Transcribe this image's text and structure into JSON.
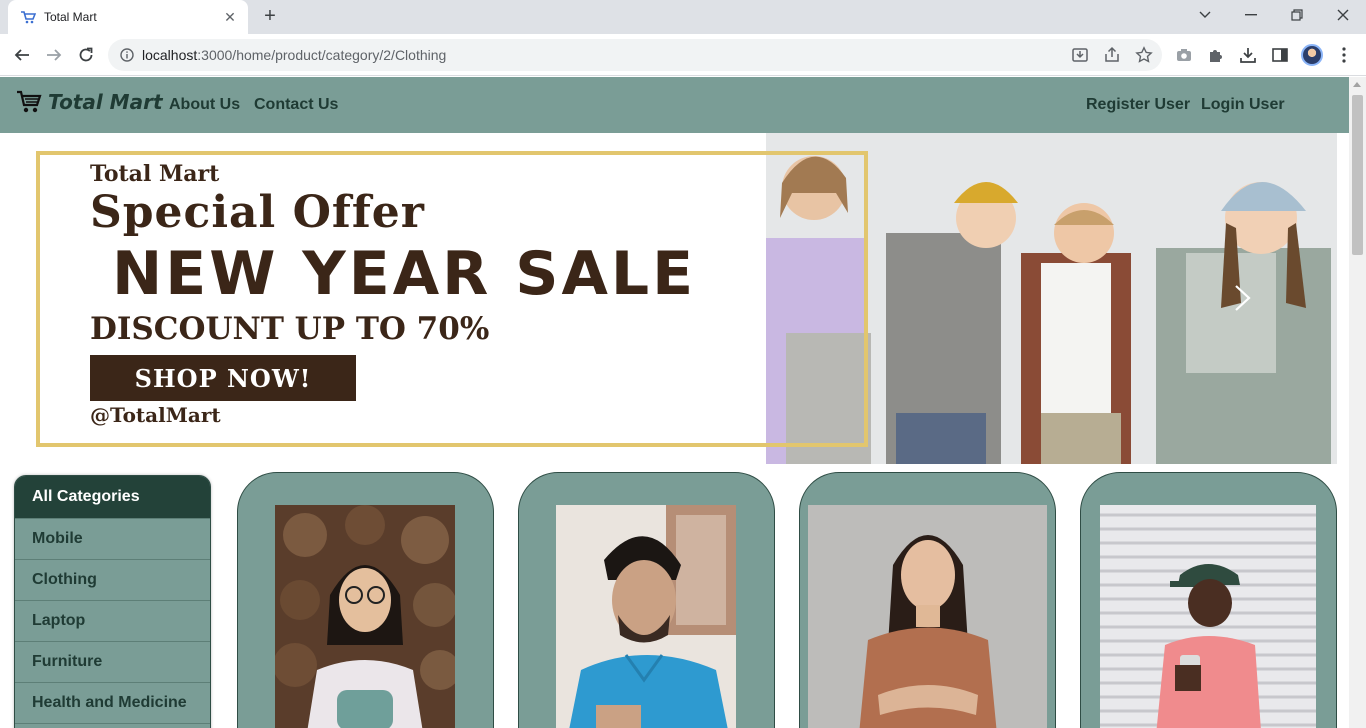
{
  "browser": {
    "tab_title": "Total Mart",
    "url_host": "localhost",
    "url_path": ":3000/home/product/category/2/Clothing"
  },
  "site": {
    "brand": "Total Mart",
    "nav_left": [
      "About Us",
      "Contact Us"
    ],
    "nav_right": [
      "Register User",
      "Login User"
    ],
    "colors": {
      "nav_bg": "#7a9d96",
      "nav_text": "#1f3b34",
      "cat_head_bg": "#234239",
      "banner_brown": "#3b2618",
      "banner_gold": "#e2c66e"
    }
  },
  "banner": {
    "line1": "Total Mart",
    "line2": "Special Offer",
    "line3": "NEW YEAR SALE",
    "line4": "DISCOUNT UP TO 70%",
    "cta": "SHOP NOW!",
    "handle": "@TotalMart"
  },
  "categories": {
    "heading": "All Categories",
    "items": [
      "Mobile",
      "Clothing",
      "Laptop",
      "Furniture",
      "Health and Medicine"
    ]
  },
  "products": [
    {
      "image": "woman-white-tee-photo"
    },
    {
      "image": "man-blue-polo-photo"
    },
    {
      "image": "woman-brown-tee-photo"
    },
    {
      "image": "man-pink-tee-photo"
    }
  ]
}
